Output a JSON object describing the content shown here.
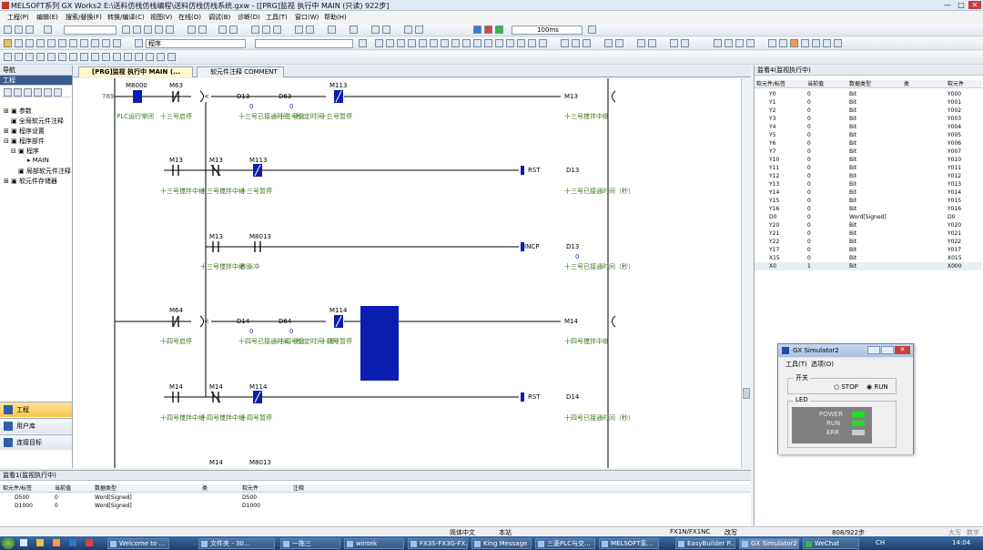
{
  "window": {
    "title": "MELSOFT系列 GX Works2 E:\\送料仿栈仿栈编程\\送料仿栈仿栈系统.gxw - [[PRG]监视 执行中 MAIN (只读) 922步]",
    "min": "—",
    "max": "□",
    "close": "✕"
  },
  "menu": [
    "工程(P)",
    "编辑(E)",
    "搜索/替换(F)",
    "转换/编译(C)",
    "视图(V)",
    "在线(O)",
    "调试(B)",
    "诊断(D)",
    "工具(T)",
    "窗口(W)",
    "帮助(H)"
  ],
  "toolbar": {
    "scan_time": "100ms",
    "program_combo": "程序"
  },
  "nav": {
    "title": "导航",
    "section": "工程",
    "tree": [
      "参数",
      "全局软元件注释",
      "程序设置",
      "程序部件",
      "程序",
      "MAIN",
      "局部软元件注释",
      "软元件存储器"
    ],
    "buttons": [
      "工程",
      "用户库",
      "连接目标"
    ]
  },
  "tabs": [
    "[PRG]监视 执行中 MAIN (...",
    "软元件注释 COMMENT"
  ],
  "ladder": {
    "step": "769",
    "contacts": [
      "M8000",
      "M63",
      "M113",
      "M13",
      "M13",
      "M13",
      "M113",
      "M13",
      "M8013",
      "M64",
      "M114",
      "M14",
      "M14",
      "M114",
      "M14",
      "M8013"
    ],
    "devices": [
      "D13",
      "D63",
      "D13",
      "D14",
      "D64",
      "D14",
      "D13"
    ],
    "values": [
      "0",
      "0",
      "0",
      "0",
      "0"
    ],
    "coils": [
      "M13",
      "M14"
    ],
    "instr": [
      "RST",
      "INCP",
      "RST"
    ],
    "cmp1": "<",
    "cmp2": "<",
    "comments": {
      "c1": "PLC运行常闭",
      "c2": "十三号启停",
      "c3": "十三号已接通时间（秒）",
      "c4": "十三号设定时间（",
      "c5": "十三号暂停",
      "c6": "十三号搅拌中继",
      "c7": "十三号搅拌中继",
      "c8": "十三号搅拌中继",
      "c9": "十三号暂停",
      "c10": "十三号已接通时间（秒）",
      "c11": "十三号搅拌中继",
      "c12": "秒脉冲",
      "c13": "十三号已接通时间（秒）",
      "c14": "十四号启停",
      "c15": "十四号已接通时间（秒）",
      "c16": "十四号设定时间（秒）",
      "c17": "十四号暂停",
      "c18": "十四号搅拌中继",
      "c19": "十四号搅拌中继",
      "c20": "十四号搅拌中继",
      "c21": "十四号暂停",
      "c22": "十四号已接通时间（秒）"
    }
  },
  "monitor4": {
    "title": "监看4(监视执行中)",
    "headers": [
      "软元件/标签",
      "当前值",
      "数据类型",
      "类",
      "软元件"
    ],
    "rows": [
      [
        "Y0",
        "0",
        "Bit",
        "Y000"
      ],
      [
        "Y1",
        "0",
        "Bit",
        "Y001"
      ],
      [
        "Y2",
        "0",
        "Bit",
        "Y002"
      ],
      [
        "Y3",
        "0",
        "Bit",
        "Y003"
      ],
      [
        "Y4",
        "0",
        "Bit",
        "Y004"
      ],
      [
        "Y5",
        "0",
        "Bit",
        "Y005"
      ],
      [
        "Y6",
        "0",
        "Bit",
        "Y006"
      ],
      [
        "Y7",
        "0",
        "Bit",
        "Y007"
      ],
      [
        "Y10",
        "0",
        "Bit",
        "Y010"
      ],
      [
        "Y11",
        "0",
        "Bit",
        "Y011"
      ],
      [
        "Y12",
        "0",
        "Bit",
        "Y012"
      ],
      [
        "Y13",
        "0",
        "Bit",
        "Y013"
      ],
      [
        "Y14",
        "0",
        "Bit",
        "Y014"
      ],
      [
        "Y15",
        "0",
        "Bit",
        "Y015"
      ],
      [
        "Y16",
        "0",
        "Bit",
        "Y016"
      ],
      [
        "D0",
        "0",
        "Word[Signed]",
        "D0"
      ],
      [
        "Y20",
        "0",
        "Bit",
        "Y020"
      ],
      [
        "Y21",
        "0",
        "Bit",
        "Y021"
      ],
      [
        "Y22",
        "0",
        "Bit",
        "Y022"
      ],
      [
        "Y17",
        "0",
        "Bit",
        "Y017"
      ],
      [
        "X15",
        "0",
        "Bit",
        "X015"
      ],
      [
        "X0",
        "1",
        "Bit",
        "X000"
      ]
    ]
  },
  "monitor1": {
    "title": "监看1(监视执行中)",
    "headers": [
      "软元件/标签",
      "当前值",
      "数据类型",
      "类",
      "软元件",
      "注释"
    ],
    "rows": [
      [
        "D500",
        "0",
        "Word[Signed]",
        "D500"
      ],
      [
        "D1000",
        "0",
        "Word[Signed]",
        "D1000"
      ]
    ]
  },
  "simulator": {
    "title": "GX Simulator2",
    "menu": [
      "工具(T)",
      "选项(O)"
    ],
    "switch_label": "开关",
    "stop": "STOP",
    "run": "RUN",
    "led_label": "LED",
    "leds": [
      {
        "name": "POWER",
        "color": "#22dd22"
      },
      {
        "name": "RUN",
        "color": "#22dd22"
      },
      {
        "name": "ERR",
        "color": "#cccccc"
      }
    ]
  },
  "status": {
    "lang": "简体中文",
    "ownstation": "本站",
    "cpu": "FX1N/FX1NC",
    "mode": "改写",
    "steps": "808/922步",
    "cap": "大写",
    "num": "数字"
  },
  "taskbar": {
    "tasks": [
      "Welcome to ...",
      "文件夹 - 30...",
      "一拖三",
      "wintek",
      "FX3S-FX3G-FX...",
      "King Message",
      "三菱PLC与交...",
      "MELSOFT系...",
      "EasyBuilder P...",
      "GX Simulator2",
      "WeChat"
    ],
    "time": "14:04",
    "ime": "CH"
  },
  "colors": {
    "active_contact": "#0a1fb0",
    "comment": "#3a7a1a",
    "value": "#1030c0"
  }
}
